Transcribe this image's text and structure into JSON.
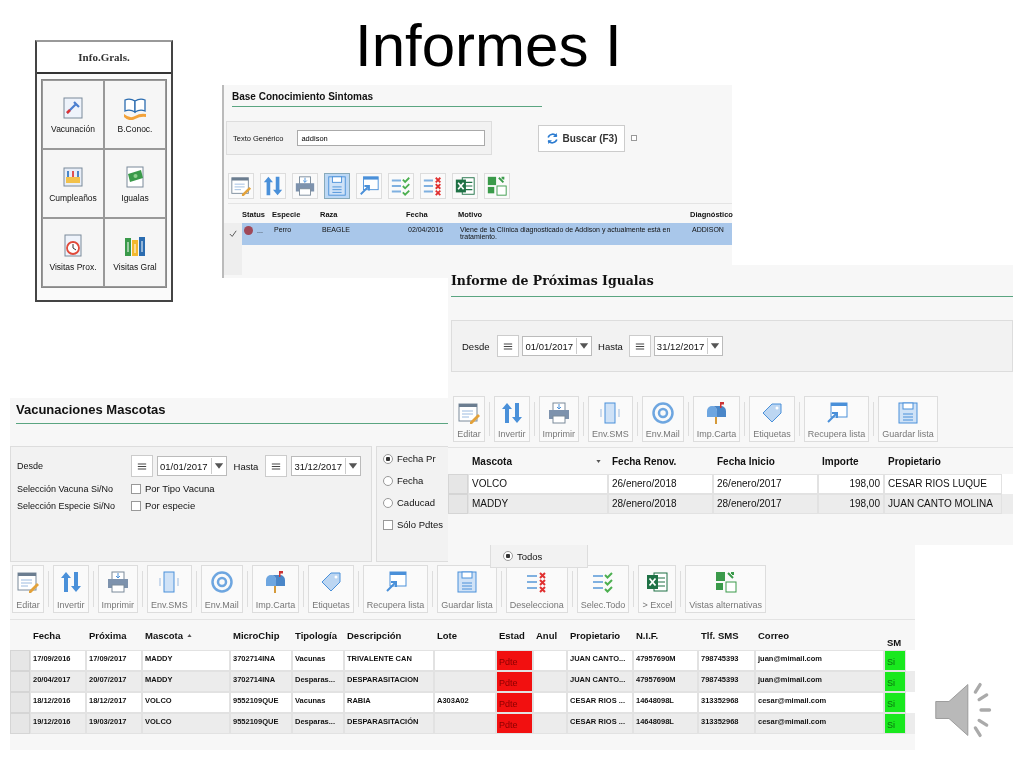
{
  "slide_title": "Informes I",
  "info_panel": {
    "title": "Info.Grals.",
    "tiles": [
      {
        "label": "Vacunación",
        "kind": "vaccine"
      },
      {
        "label": "B.Conoc.",
        "kind": "book"
      },
      {
        "label": "Cumpleaños",
        "kind": "birthday"
      },
      {
        "label": "Igualas",
        "kind": "money"
      },
      {
        "label": "Visitas Prox.",
        "kind": "clock"
      },
      {
        "label": "Visitas Gral",
        "kind": "books"
      }
    ]
  },
  "symptoms_panel": {
    "title": "Base Conocimiento Sintomas",
    "search_label": "Texto Genérico",
    "search_value": "addison",
    "search_button": "Buscar (F3)",
    "option_checked": false,
    "toolbar": [
      {
        "kind": "edit",
        "selected": false
      },
      {
        "kind": "invert",
        "selected": false
      },
      {
        "kind": "print",
        "selected": false
      },
      {
        "kind": "save",
        "selected": true
      },
      {
        "kind": "restore",
        "selected": false
      },
      {
        "kind": "selectall",
        "selected": false
      },
      {
        "kind": "deselect",
        "selected": false
      },
      {
        "kind": "excel",
        "selected": false
      },
      {
        "kind": "views",
        "selected": false
      }
    ],
    "columns": [
      "Status",
      "Especie",
      "Raza",
      "Fecha",
      "Motivo",
      "Diagnóstico"
    ],
    "rows": [
      {
        "selected": true,
        "color": "#a04858",
        "cells": [
          "...",
          "Perro",
          "BEAGLE",
          "02/04/2016",
          "Viene de la Clínica diagnosticado de Addison y actualmente está en tratamiento.",
          "ADDISON"
        ]
      }
    ]
  },
  "vacunaciones_panel": {
    "title": "Vacunaciones Mascotas",
    "from_label": "Desde",
    "from_date": "01/01/2017",
    "to_label": "Hasta",
    "to_date": "31/12/2017",
    "vaccine_filter": {
      "label": "Selección Vacuna Si/No",
      "option": "Por Tipo Vacuna",
      "checked": false
    },
    "species_filter": {
      "label": "Selección Especie Si/No",
      "option": "Por especie",
      "checked": false
    },
    "date_options": [
      {
        "label": "Fecha Pr",
        "selected": true
      },
      {
        "label": "Fecha",
        "selected": false
      },
      {
        "label": "Caducad",
        "selected": false
      }
    ],
    "pending_only": {
      "label": "Sólo Pdtes",
      "checked": false
    },
    "scope_option": {
      "label": "Todos",
      "selected": true
    },
    "toolbar": [
      {
        "kind": "edit",
        "label": "Editar"
      },
      {
        "kind": "invert",
        "label": "Invertir"
      },
      {
        "kind": "print",
        "label": "Imprimir"
      },
      {
        "kind": "phone",
        "label": "Env.SMS"
      },
      {
        "kind": "at",
        "label": "Env.Mail"
      },
      {
        "kind": "mailbox",
        "label": "Imp.Carta"
      },
      {
        "kind": "tag",
        "label": "Etiquetas"
      },
      {
        "kind": "restore",
        "label": "Recupera lista"
      },
      {
        "kind": "save",
        "label": "Guardar lista"
      },
      {
        "kind": "deselect",
        "label": "Deselecciona"
      },
      {
        "kind": "selectall",
        "label": "Selec.Todo"
      },
      {
        "kind": "excel",
        "label": "> Excel"
      },
      {
        "kind": "views",
        "label": "Vistas alternativas"
      }
    ],
    "columns": [
      {
        "label": "Fecha"
      },
      {
        "label": "Próxima"
      },
      {
        "label": "Mascota",
        "sorted": true,
        "ascending": true
      },
      {
        "label": "MicroChip"
      },
      {
        "label": "Tipología"
      },
      {
        "label": "Descripción"
      },
      {
        "label": "Lote"
      },
      {
        "label": "Estad"
      },
      {
        "label": "Anul"
      },
      {
        "label": "Propietario"
      },
      {
        "label": "N.I.F."
      },
      {
        "label": "Tlf. SMS"
      },
      {
        "label": "Correo"
      },
      {
        "label": "SM"
      }
    ],
    "rows": [
      {
        "fecha": "17/09/2016",
        "proxima": "17/09/2017",
        "mascota": "MADDY",
        "microchip": "3702714INA",
        "tipologia": "Vacunas",
        "descripcion": "TRIVALENTE CAN",
        "estado": "Pdte",
        "propietario": "JUAN CANTO...",
        "nif": "47957690M",
        "tlf": "798745393",
        "correo": "juan@mimail.com",
        "sms": "Si"
      },
      {
        "fecha": "20/04/2017",
        "proxima": "20/07/2017",
        "mascota": "MADDY",
        "microchip": "3702714INA",
        "tipologia": "Desparas...",
        "descripcion": "DESPARASITACION",
        "estado": "Pdte",
        "propietario": "JUAN CANTO...",
        "nif": "47957690M",
        "tlf": "798745393",
        "correo": "juan@mimail.com",
        "sms": "Si"
      },
      {
        "fecha": "18/12/2016",
        "proxima": "18/12/2017",
        "mascota": "VOLCO",
        "microchip": "9552109QUE",
        "tipologia": "Vacunas",
        "descripcion": "RABIA",
        "lote": "A303A02",
        "estado": "Pdte",
        "propietario": "CESAR RIOS ...",
        "nif": "14648098L",
        "tlf": "313352968",
        "correo": "cesar@mimail.com",
        "sms": "Si"
      },
      {
        "fecha": "19/12/2016",
        "proxima": "19/03/2017",
        "mascota": "VOLCO",
        "microchip": "9552109QUE",
        "tipologia": "Desparas...",
        "descripcion": "DESPARASITACIÓN",
        "estado": "Pdte",
        "propietario": "CESAR RIOS ...",
        "nif": "14648098L",
        "tlf": "313352968",
        "correo": "cesar@mimail.com",
        "sms": "Si"
      }
    ]
  },
  "igualas_panel": {
    "title": "Informe de Próximas Igualas",
    "from_label": "Desde",
    "from_date": "01/01/2017",
    "to_label": "Hasta",
    "to_date": "31/12/2017",
    "toolbar": [
      {
        "kind": "edit",
        "label": "Editar"
      },
      {
        "kind": "invert",
        "label": "Invertir"
      },
      {
        "kind": "print",
        "label": "Imprimir"
      },
      {
        "kind": "phone",
        "label": "Env.SMS"
      },
      {
        "kind": "at",
        "label": "Env.Mail"
      },
      {
        "kind": "mailbox",
        "label": "Imp.Carta"
      },
      {
        "kind": "tag",
        "label": "Etiquetas"
      },
      {
        "kind": "restore",
        "label": "Recupera lista"
      },
      {
        "kind": "save",
        "label": "Guardar lista"
      }
    ],
    "columns": [
      {
        "label": "Mascota",
        "sorted": true,
        "ascending": false
      },
      {
        "label": "Fecha Renov."
      },
      {
        "label": "Fecha Inicio"
      },
      {
        "label": "Importe"
      },
      {
        "label": "Propietario"
      }
    ],
    "rows": [
      [
        "VOLCO",
        "26/enero/2018",
        "26/enero/2017",
        "198,00",
        "CESAR RIOS LUQUE"
      ],
      [
        "MADDY",
        "28/enero/2018",
        "28/enero/2017",
        "198,00",
        "JUAN CANTO MOLINA"
      ]
    ]
  }
}
